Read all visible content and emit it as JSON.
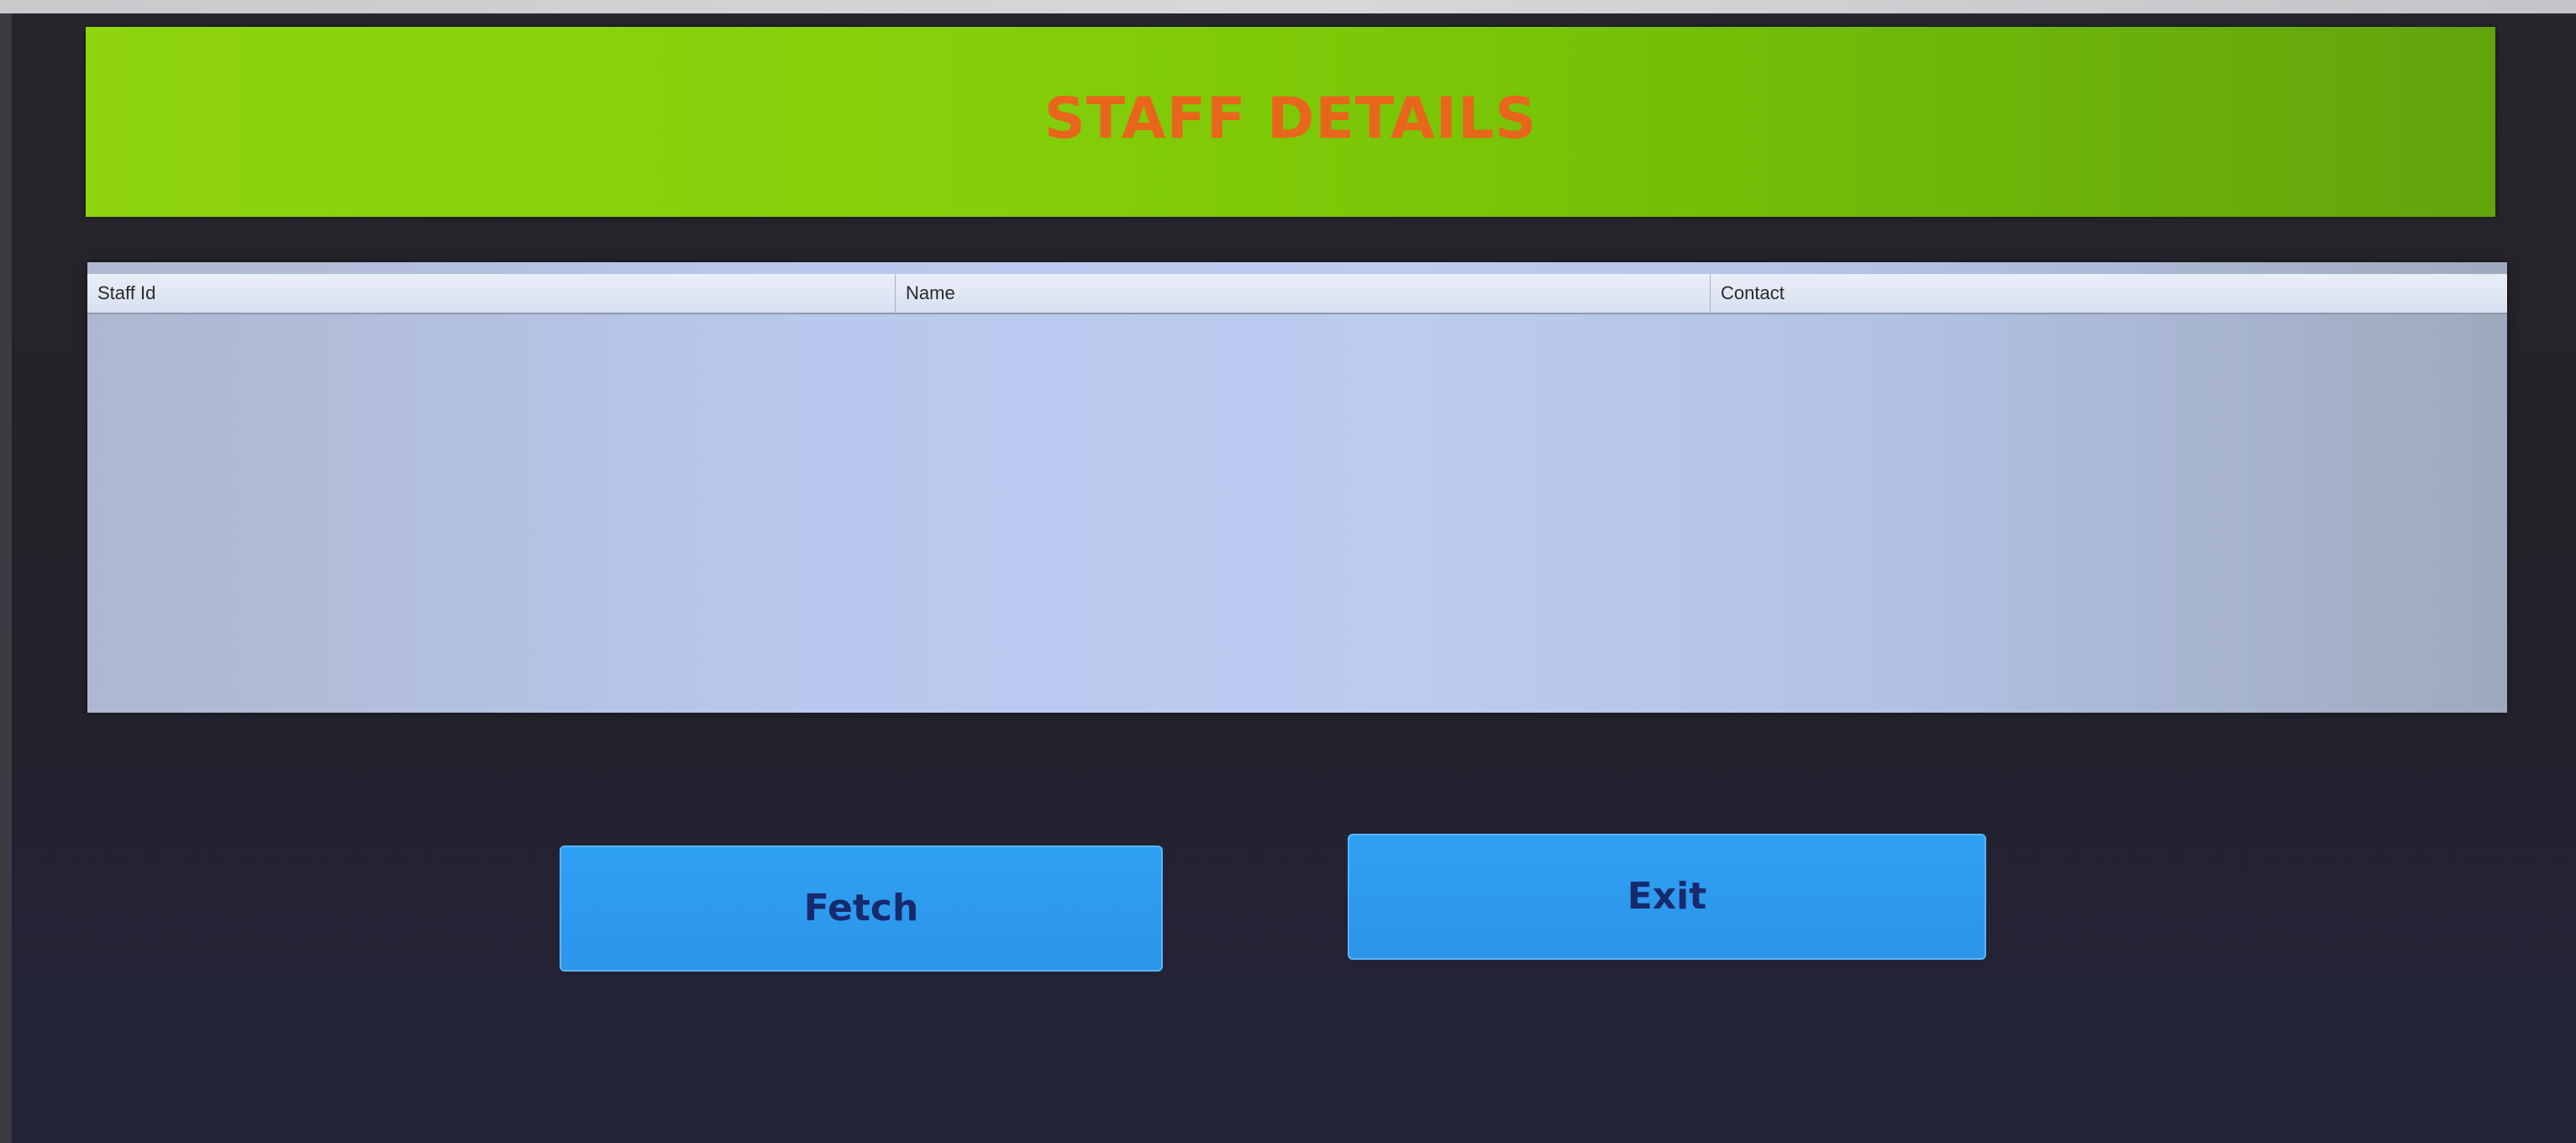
{
  "header": {
    "title": "STAFF DETAILS"
  },
  "table": {
    "columns": [
      "Staff Id",
      "Name",
      "Contact"
    ],
    "rows": []
  },
  "buttons": {
    "fetch_label": "Fetch",
    "exit_label": "Exit"
  },
  "colors": {
    "banner": "#86cf0a",
    "title": "#e8661c",
    "button": "#2c95ea",
    "button_text": "#172a6e",
    "table_background": "#bccbf0",
    "window_background": "#24242c"
  }
}
